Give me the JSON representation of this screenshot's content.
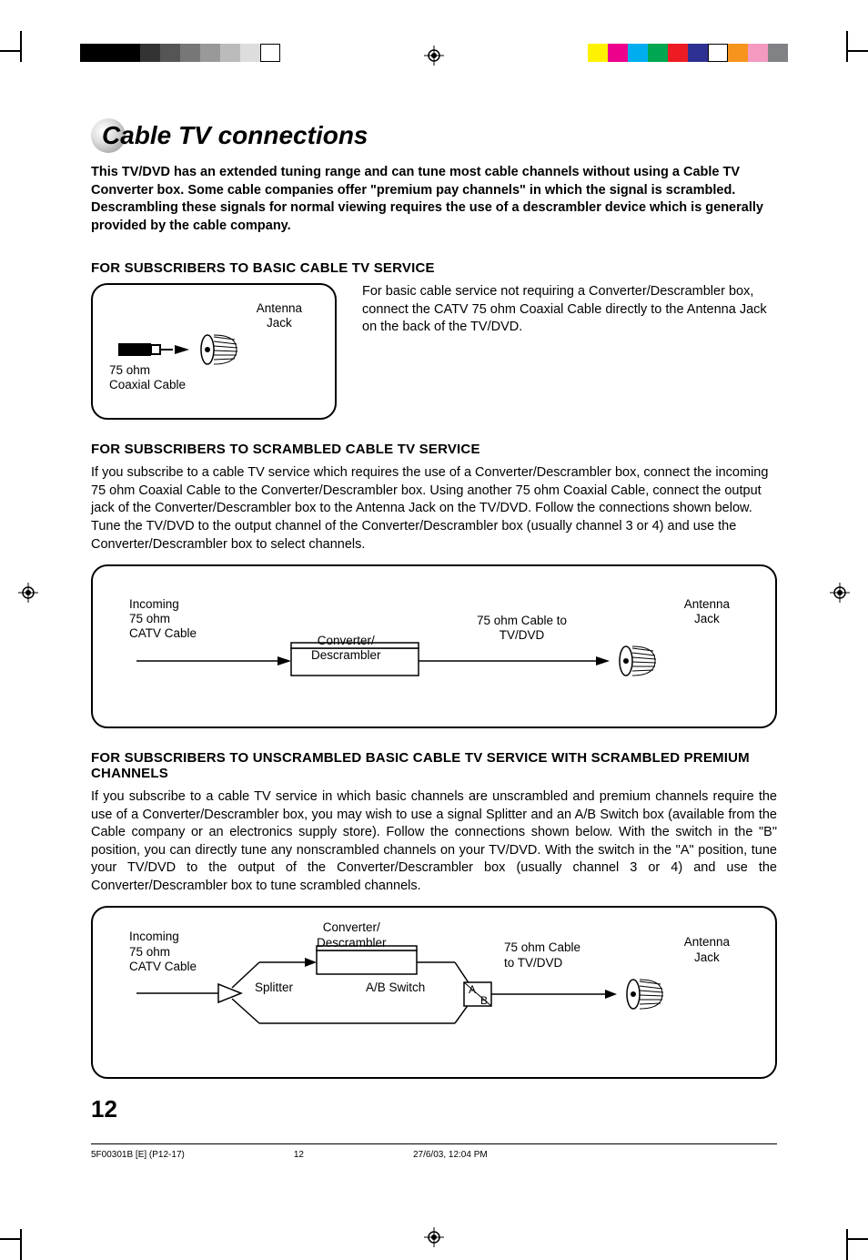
{
  "title": "Cable TV connections",
  "intro": "This TV/DVD has an extended tuning range and can tune most cable channels without using a Cable TV Converter box. Some cable companies offer \"premium pay channels\" in which the signal is scrambled. Descrambling these signals for normal viewing requires the use of a descrambler device which is generally provided by the cable company.",
  "section1": {
    "heading": "FOR SUBSCRIBERS TO BASIC CABLE TV SERVICE",
    "text": "For basic cable service not requiring a Converter/Descrambler box, connect the CATV 75 ohm Coaxial Cable directly to the Antenna Jack on the back of the TV/DVD.",
    "labels": {
      "coax": "75 ohm\nCoaxial Cable",
      "antenna": "Antenna\nJack"
    }
  },
  "section2": {
    "heading": "FOR SUBSCRIBERS TO SCRAMBLED CABLE TV SERVICE",
    "text": "If you subscribe to a cable TV service which requires the use of a Converter/Descrambler box, connect the incoming 75 ohm Coaxial Cable to the Converter/Descrambler box. Using another 75 ohm Coaxial Cable, connect the output jack of the Converter/Descrambler box to the Antenna Jack on the TV/DVD. Follow the connections shown below. Tune the TV/DVD to the output channel of the Converter/Descrambler box (usually channel 3 or 4) and use the Converter/Descrambler box to select channels.",
    "labels": {
      "incoming": "Incoming\n75 ohm\nCATV Cable",
      "converter": "Converter/\nDescrambler",
      "cable_to_tv": "75 ohm Cable to\nTV/DVD",
      "antenna": "Antenna\nJack"
    }
  },
  "section3": {
    "heading": "FOR SUBSCRIBERS TO UNSCRAMBLED BASIC CABLE TV SERVICE WITH SCRAMBLED PREMIUM CHANNELS",
    "text": "If you subscribe to a cable TV service in which basic channels are unscrambled and premium channels require the use of a Converter/Descrambler box, you may wish to use a signal Splitter and an A/B Switch box (available from the Cable company or an electronics supply store). Follow the connections shown below. With the switch in the \"B\" position, you can directly tune any nonscrambled channels on your TV/DVD. With the switch in the \"A\" position, tune your TV/DVD to the output of the Converter/Descrambler box (usually channel 3 or 4) and use the Converter/Descrambler box to tune scrambled channels.",
    "labels": {
      "incoming": "Incoming\n75 ohm\nCATV Cable",
      "splitter": "Splitter",
      "converter": "Converter/\nDescrambler",
      "ab_switch": "A/B Switch",
      "a": "A",
      "b": "B",
      "cable_to_tv": "75 ohm Cable\nto TV/DVD",
      "antenna": "Antenna\nJack"
    }
  },
  "page_number": "12",
  "footer": {
    "file": "5F00301B [E] (P12-17)",
    "page": "12",
    "date": "27/6/03, 12:04 PM"
  }
}
